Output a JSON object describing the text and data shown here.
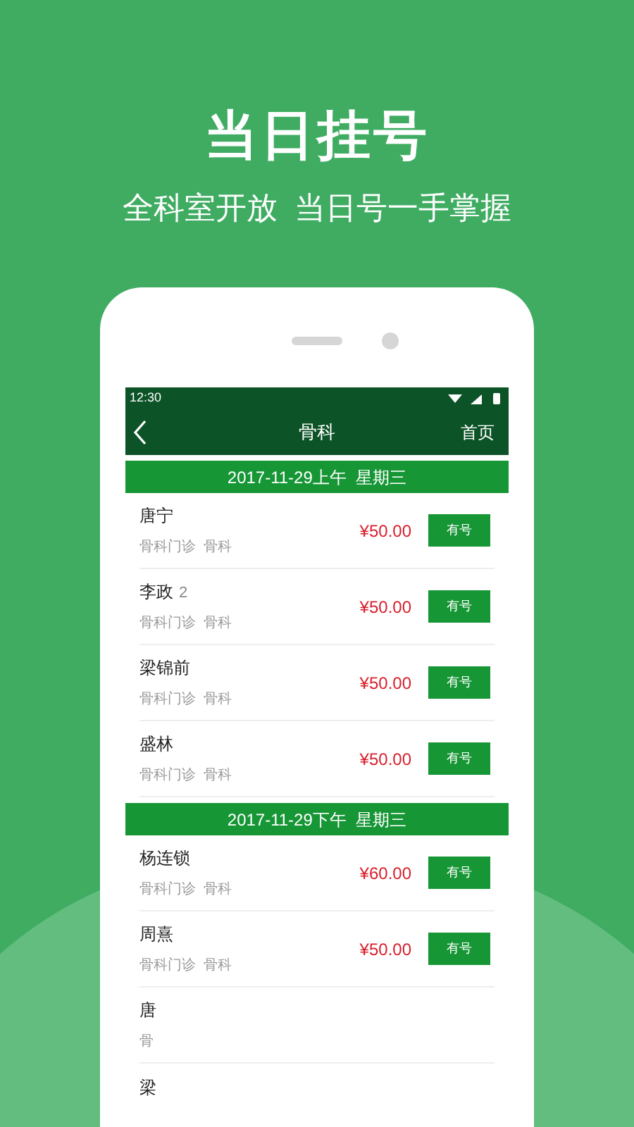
{
  "headline": "当日挂号",
  "tagline": "全科室开放  当日号一手掌握",
  "status_bar": {
    "time": "12:30"
  },
  "header": {
    "title": "骨科",
    "right_link": "首页"
  },
  "sections": [
    {
      "date": "2017-11-29上午  星期三",
      "rows": [
        {
          "name": "唐宁",
          "detail": "骨科门诊  骨科",
          "price": "¥50.00",
          "button": "有号"
        },
        {
          "name": "李政",
          "badge": "2",
          "detail": "骨科门诊  骨科",
          "price": "¥50.00",
          "button": "有号"
        },
        {
          "name": "梁锦前",
          "detail": "骨科门诊  骨科",
          "price": "¥50.00",
          "button": "有号"
        },
        {
          "name": "盛林",
          "detail": "骨科门诊  骨科",
          "price": "¥50.00",
          "button": "有号"
        }
      ]
    },
    {
      "date": "2017-11-29下午  星期三",
      "rows": [
        {
          "name": "杨连锁",
          "detail": "骨科门诊  骨科",
          "price": "¥60.00",
          "button": "有号"
        },
        {
          "name": "周熹",
          "detail": "骨科门诊  骨科",
          "price": "¥50.00",
          "button": "有号"
        },
        {
          "name": "唐",
          "detail": "骨"
        },
        {
          "name": "梁"
        }
      ]
    }
  ]
}
